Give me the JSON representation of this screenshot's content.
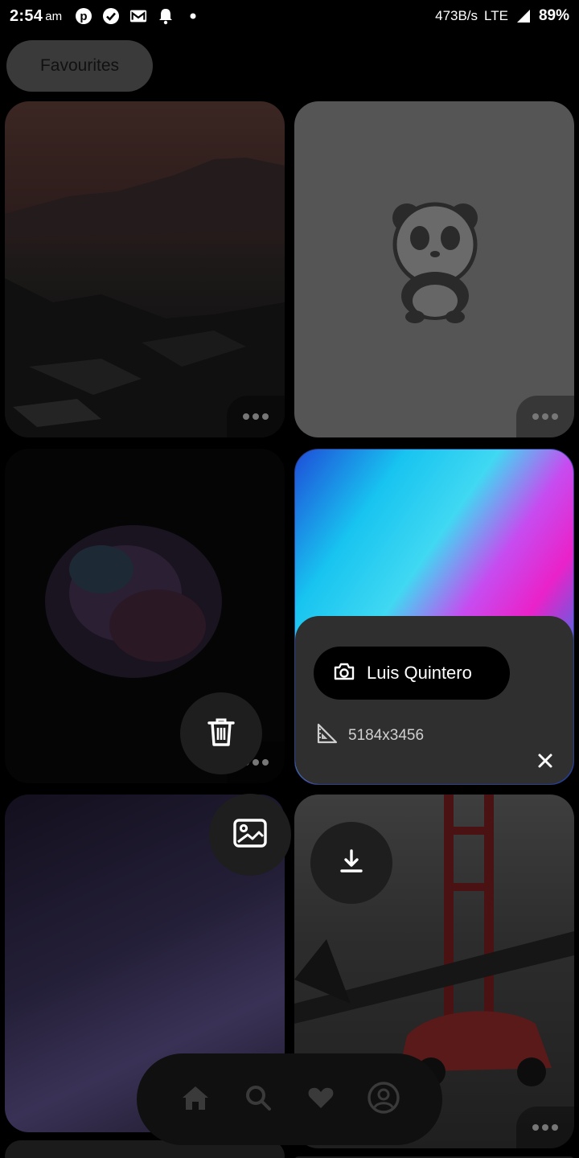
{
  "status_bar": {
    "time": "2:54",
    "ampm": "am",
    "network_speed": "473B/s",
    "network_type": "LTE",
    "battery": "89%",
    "icons": [
      "pinterest-icon",
      "check-circle-icon",
      "gmail-icon",
      "bell-icon",
      "dot-icon",
      "signal-icon"
    ]
  },
  "header": {
    "chip_label": "Favourites"
  },
  "info_panel": {
    "author": "Luis Quintero",
    "resolution": "5184x3456"
  },
  "actions": [
    "delete",
    "set-wallpaper",
    "download"
  ],
  "nav": {
    "items": [
      "home",
      "search",
      "favourites",
      "profile"
    ]
  },
  "colors": {
    "panel": "#2f2f2f",
    "fab": "#1e1e1e",
    "nav": "#101010",
    "background": "#000000"
  }
}
